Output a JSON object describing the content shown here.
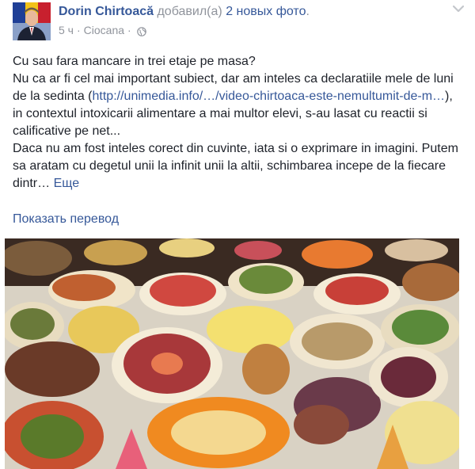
{
  "header": {
    "author_name": "Dorin Chirtoacă",
    "action_text": "добавил(а)",
    "photos_link": "2 новых фото",
    "time": "5 ч",
    "location": "Ciocana",
    "separator": "·",
    "icons": {
      "menu": "chevron-down-icon",
      "privacy": "globe-icon"
    }
  },
  "post": {
    "lines": [
      "Cu sau fara mancare in trei etaje pe masa?",
      "Nu ca ar fi cel mai important subiect, dar am inteles ca declaratiile mele de luni de la sedinta (",
      "http://unimedia.info/…/video-chirtoaca-este-nemultumit-de-m…",
      "), in contextul intoxicarii alimentare a mai multor elevi, s-au lasat cu reactii si calificative pe net...",
      "Daca nu am fost inteles corect din cuvinte, iata si o exprimare in imagini. Putem sa aratam cu degetul unii la infinit unii la altii, schimbarea incepe de la fiecare dintr…"
    ],
    "see_more": "Еще"
  },
  "translate": "Показать перевод",
  "colors": {
    "link": "#365899",
    "meta": "#90949c",
    "text": "#1d2129"
  }
}
